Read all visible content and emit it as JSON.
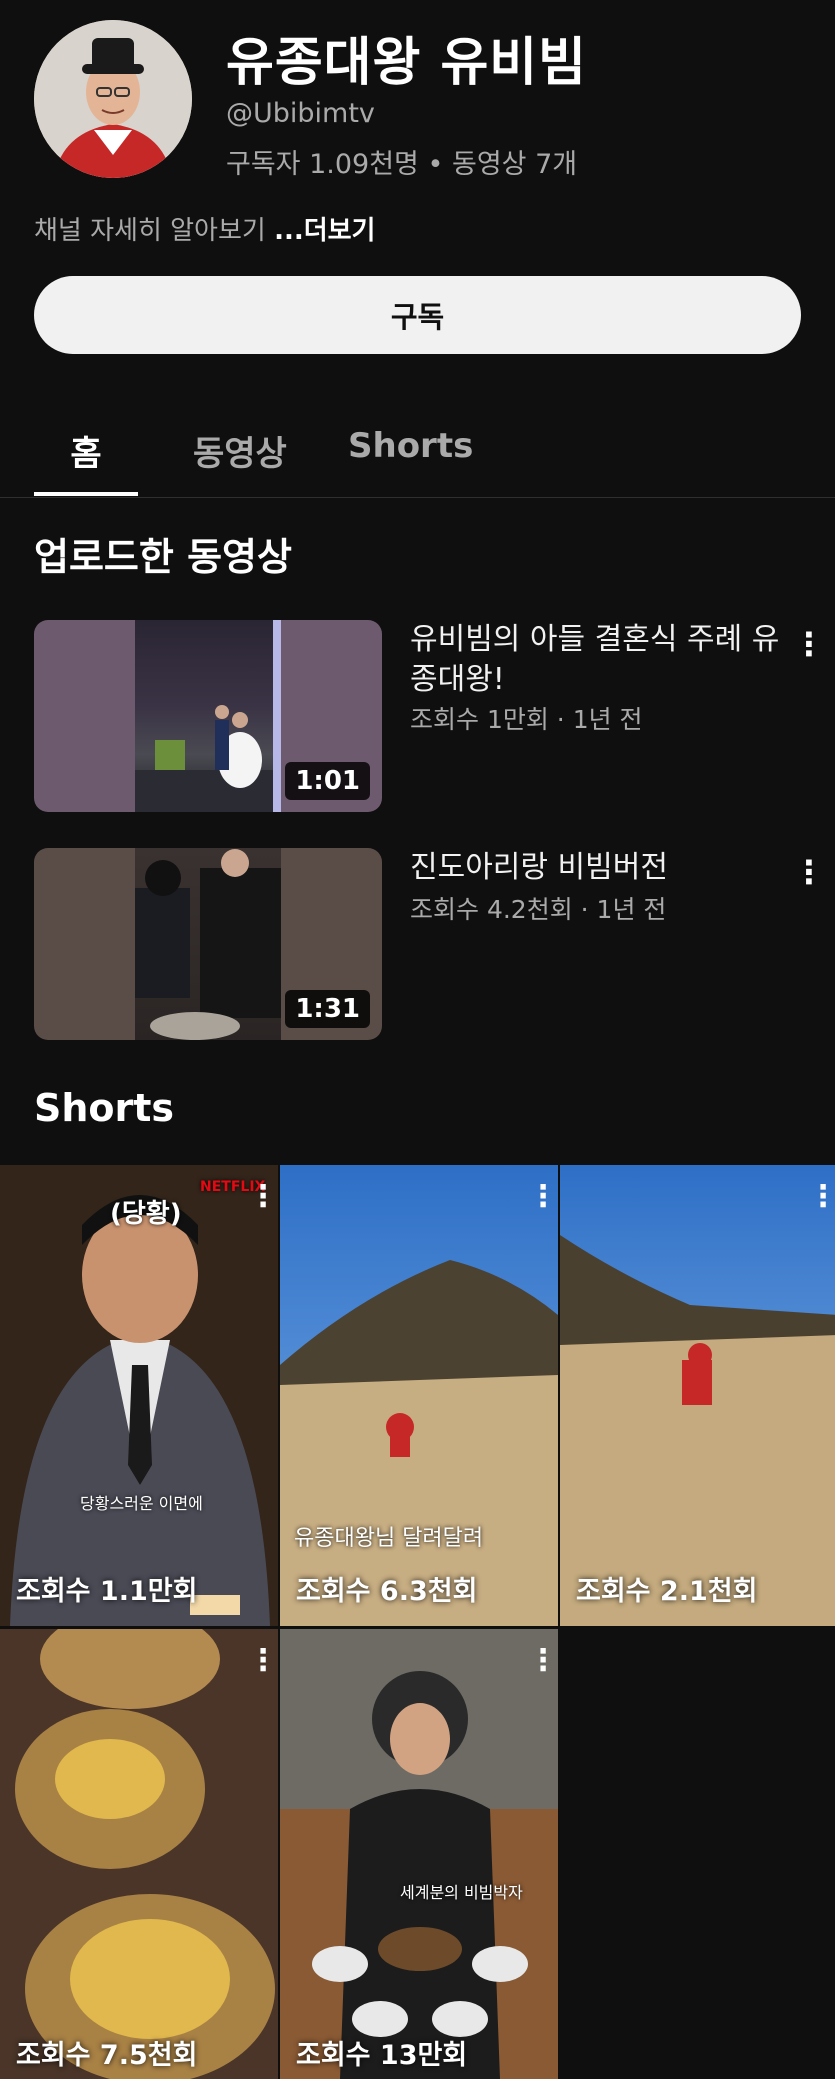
{
  "channel": {
    "name": "유종대왕 유비빔",
    "handle": "@Ubibimtv",
    "stats": "구독자 1.09천명 • 동영상 7개",
    "about_text": "채널 자세히 알아보기 ",
    "about_more": "...더보기",
    "subscribe_label": "구독"
  },
  "tabs": [
    {
      "label": "홈",
      "active": true
    },
    {
      "label": "동영상",
      "active": false
    },
    {
      "label": "Shorts",
      "active": false
    }
  ],
  "uploads": {
    "section_title": "업로드한 동영상",
    "videos": [
      {
        "title": "유비빔의 아들 결혼식  주례 유종대왕!",
        "meta": "조회수 1만회 · 1년 전",
        "duration": "1:01"
      },
      {
        "title": "진도아리랑 비빔버전",
        "meta": "조회수 4.2천회 · 1년 전",
        "duration": "1:31"
      }
    ]
  },
  "shorts": {
    "section_title": "Shorts",
    "items": [
      {
        "views": "조회수 1.1만회",
        "caption": "당황스러운 이면에",
        "overlay": "(당황)",
        "brand": "NETFLIX"
      },
      {
        "views": "조회수 6.3천회",
        "caption": "유종대왕님 달려달려"
      },
      {
        "views": "조회수 2.1천회",
        "caption": ""
      },
      {
        "views": "조회수 7.5천회",
        "caption": ""
      },
      {
        "views": "조회수 13만회",
        "caption": "세계분의 비빔박자"
      }
    ]
  },
  "icons": {
    "kebab": "more-vert-icon"
  },
  "colors": {
    "background": "#0f0f0f",
    "text_primary": "#f1f1f1",
    "text_secondary": "#aaaaaa",
    "subscribe_bg": "#f1f1f1"
  }
}
